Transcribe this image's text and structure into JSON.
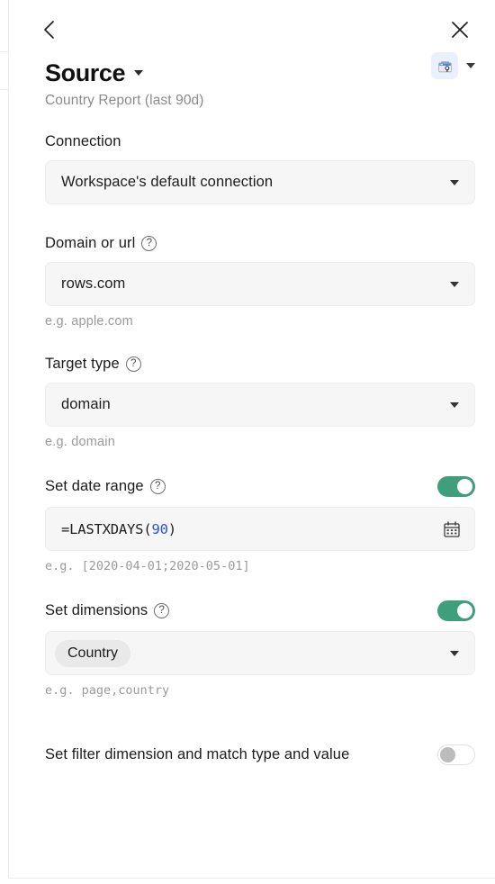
{
  "window": {
    "back_icon": "chevron-left-icon",
    "close_icon": "close-icon"
  },
  "header": {
    "title": "Source",
    "title_caret_icon": "chevron-down-icon",
    "subtitle": "Country Report (last 90d)",
    "app_icon": "google-search-console-icon",
    "app_caret_icon": "chevron-down-icon"
  },
  "colors": {
    "toggle_on": "#3f9e7c",
    "toggle_off_knob": "#bcbcbc",
    "field_bg": "#f6f6f6",
    "chip_bg": "#e9e9e9",
    "formula_number": "#2b4fe0",
    "app_badge_bg": "#eaf0fd"
  },
  "fields": {
    "connection": {
      "label": "Connection",
      "value": "Workspace's default connection",
      "caret_icon": "chevron-down-icon"
    },
    "domain_or_url": {
      "label": "Domain or url",
      "help_icon": "help-circle-icon",
      "value": "rows.com",
      "caret_icon": "chevron-down-icon",
      "hint": "e.g. apple.com"
    },
    "target_type": {
      "label": "Target type",
      "help_icon": "help-circle-icon",
      "value": "domain",
      "caret_icon": "chevron-down-icon",
      "hint": "e.g. domain"
    },
    "date_range": {
      "label": "Set date range",
      "help_icon": "help-circle-icon",
      "toggle_state": "on",
      "formula_prefix": "=LASTXDAYS(",
      "formula_number": "90",
      "formula_suffix": ")",
      "calendar_icon": "calendar-icon",
      "hint": "e.g. [2020-04-01;2020-05-01]"
    },
    "dimensions": {
      "label": "Set dimensions",
      "help_icon": "help-circle-icon",
      "toggle_state": "on",
      "chips": "Country",
      "caret_icon": "chevron-down-icon",
      "hint": "e.g. page,country"
    },
    "filter": {
      "label": "Set filter dimension and match type and value",
      "toggle_state": "off"
    }
  }
}
